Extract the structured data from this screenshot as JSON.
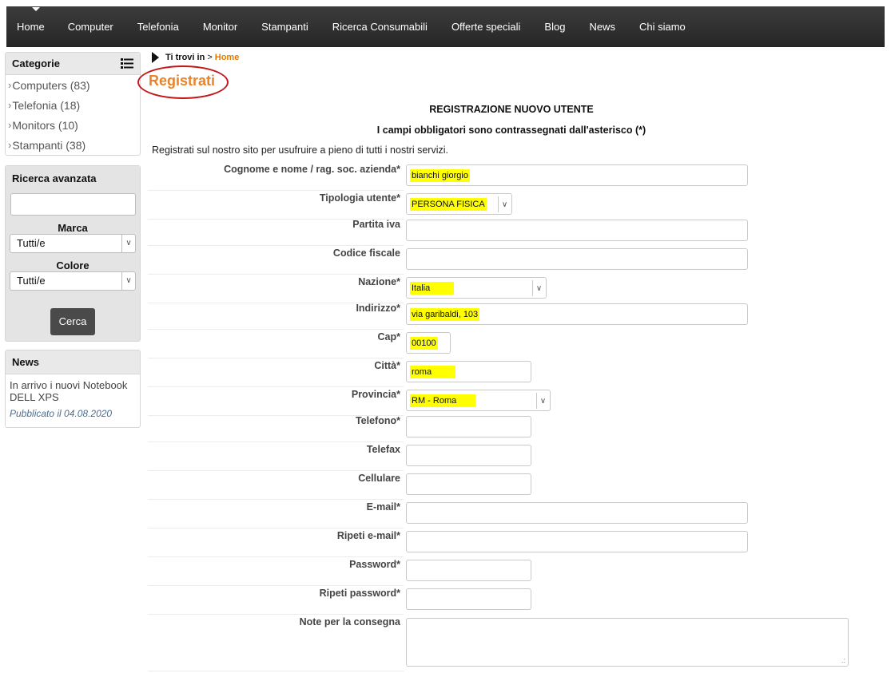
{
  "nav": {
    "items": [
      "Home",
      "Computer",
      "Telefonia",
      "Monitor",
      "Stampanti",
      "Ricerca Consumabili",
      "Offerte speciali",
      "Blog",
      "News",
      "Chi siamo"
    ]
  },
  "categories": {
    "title": "Categorie",
    "items": [
      "Computers (83)",
      "Telefonia (18)",
      "Monitors (10)",
      "Stampanti (38)"
    ]
  },
  "advanced_search": {
    "title": "Ricerca avanzata",
    "query_value": "",
    "brand_label": "Marca",
    "brand_value": "Tutti/e",
    "color_label": "Colore",
    "color_value": "Tutti/e",
    "button": "Cerca"
  },
  "news": {
    "title": "News",
    "item_title": "In arrivo i nuovi Notebook DELL XPS",
    "item_date": "Pubblicato il 04.08.2020"
  },
  "breadcrumb": {
    "prefix": "Ti trovi in",
    "separator": ">",
    "current": "Home"
  },
  "page_title": "Registrati",
  "form": {
    "heading": "REGISTRAZIONE NUOVO UTENTE",
    "subheading": "I campi obbligatori sono contrassegnati dall'asterisco (*)",
    "intro": "Registrati sul nostro sito per usufruire a pieno di tutti i nostri servizi.",
    "fields": [
      {
        "label": "Cognome e nome / rag. soc. azienda*",
        "value": "bianchi giorgio"
      },
      {
        "label": "Tipologia utente*",
        "value": "PERSONA FISICA"
      },
      {
        "label": "Partita iva",
        "value": ""
      },
      {
        "label": "Codice fiscale",
        "value": ""
      },
      {
        "label": "Nazione*",
        "value": "Italia"
      },
      {
        "label": "Indirizzo*",
        "value": "via garibaldi, 103"
      },
      {
        "label": "Cap*",
        "value": "00100"
      },
      {
        "label": "Città*",
        "value": "roma"
      },
      {
        "label": "Provincia*",
        "value": "RM - Roma"
      },
      {
        "label": "Telefono*",
        "value": ""
      },
      {
        "label": "Telefax",
        "value": ""
      },
      {
        "label": "Cellulare",
        "value": ""
      },
      {
        "label": "E-mail*",
        "value": ""
      },
      {
        "label": "Ripeti e-mail*",
        "value": ""
      },
      {
        "label": "Password*",
        "value": ""
      },
      {
        "label": "Ripeti password*",
        "value": ""
      },
      {
        "label": "Note per la consegna",
        "value": ""
      }
    ]
  },
  "colors": {
    "accent": "#e8832a",
    "highlight": "#ffff00",
    "nav_bg": "#2f2f2f",
    "ring": "#c2171b"
  }
}
